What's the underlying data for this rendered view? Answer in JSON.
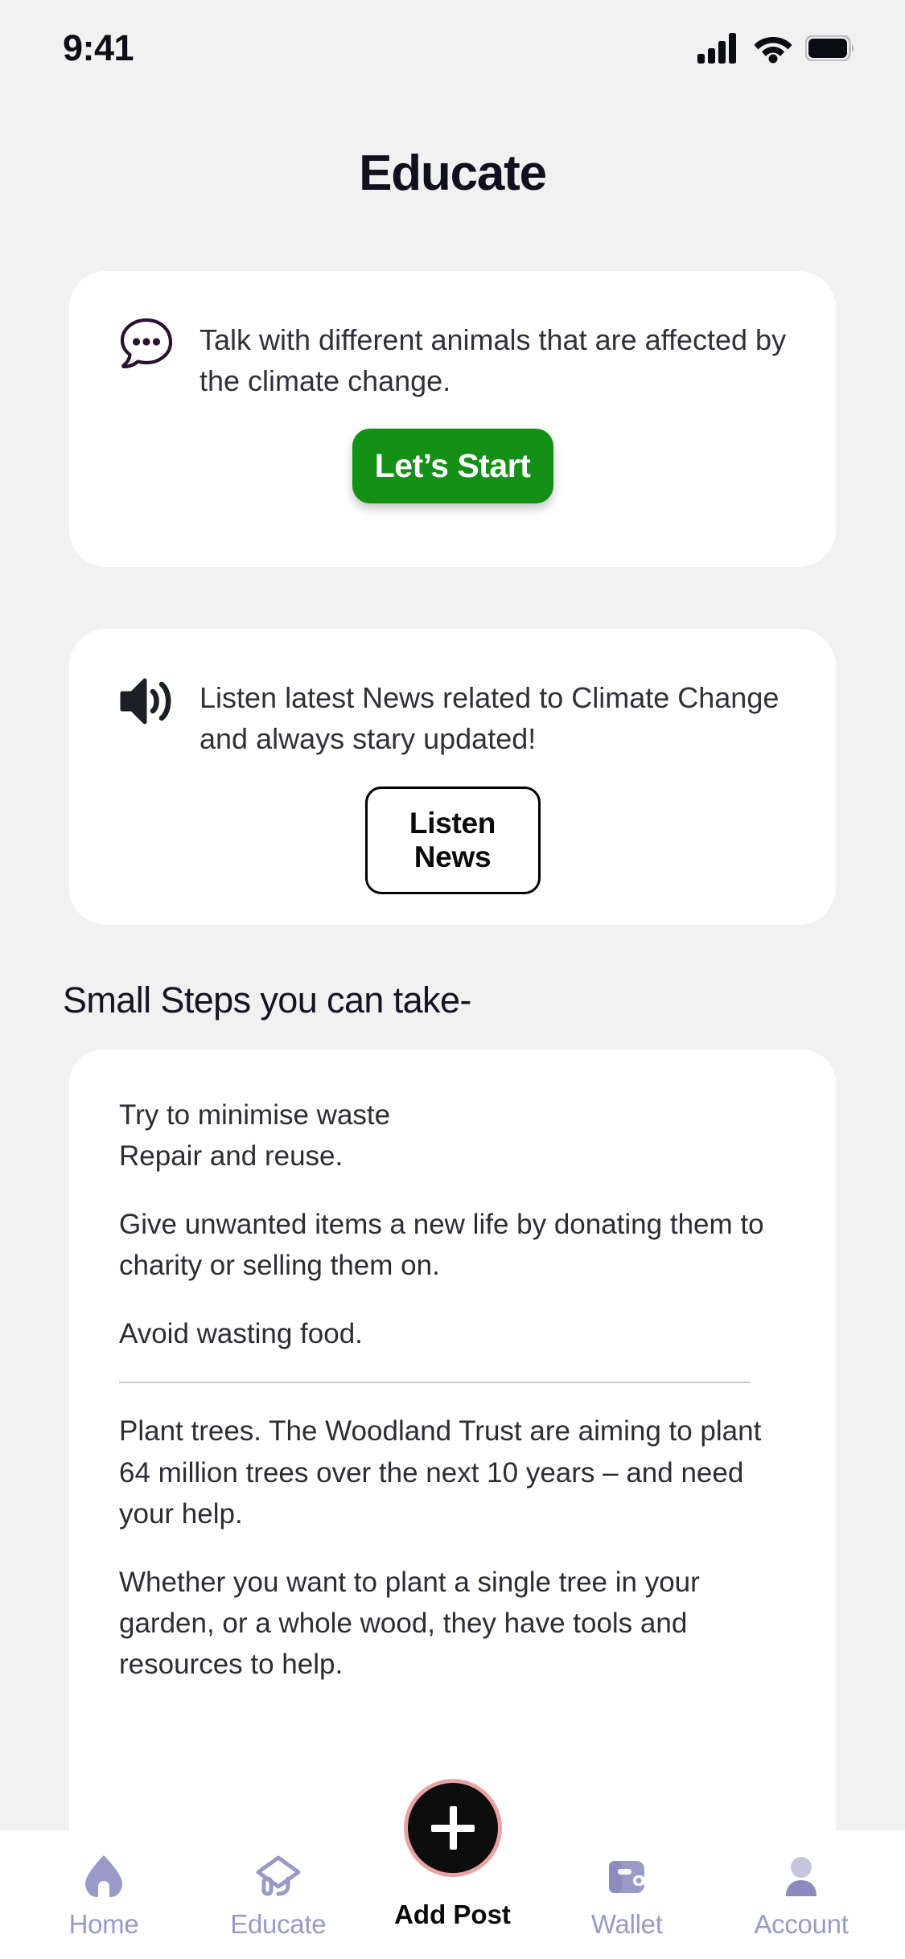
{
  "status_bar": {
    "time": "9:41",
    "icons": [
      "cellular-signal-icon",
      "wifi-icon",
      "battery-icon"
    ]
  },
  "header": {
    "title": "Educate"
  },
  "cards": {
    "talk": {
      "icon": "chat-bubble-dots-icon",
      "text": "Talk with different animals that are affected by the climate change.",
      "button_label": "Let’s Start",
      "button_color": "#139015"
    },
    "listen": {
      "icon": "speaker-volume-icon",
      "text": "Listen latest News related to Climate Change and always stary updated!",
      "button_label": "Listen News",
      "button_border_color": "#000000"
    }
  },
  "section": {
    "heading": "Small Steps you can take-",
    "paragraphs": [
      "Try to minimise waste\nRepair and reuse.",
      "Give unwanted items a new life by donating them to charity or selling them on.",
      "Avoid wasting food."
    ],
    "paragraphs_after_divider": [
      "Plant trees. The Woodland Trust are aiming to plant 64 million trees over the next 10 years – and need your help.",
      "Whether you want to plant a single tree in your garden, or a whole wood, they have tools and resources to help."
    ],
    "scroll_indicator": "↓"
  },
  "bottom_nav": {
    "items": [
      {
        "label": "Home",
        "icon": "home-icon"
      },
      {
        "label": "Educate",
        "icon": "graduation-cap-icon"
      },
      {
        "label": "Wallet",
        "icon": "wallet-icon"
      },
      {
        "label": "Account",
        "icon": "person-icon"
      }
    ],
    "fab": {
      "label": "Add Post",
      "icon": "plus-icon",
      "ring_color": "#e8a4a4",
      "fill_color": "#0d0d0d"
    },
    "inactive_color": "#9a9ac6",
    "active_color": "#080808"
  }
}
